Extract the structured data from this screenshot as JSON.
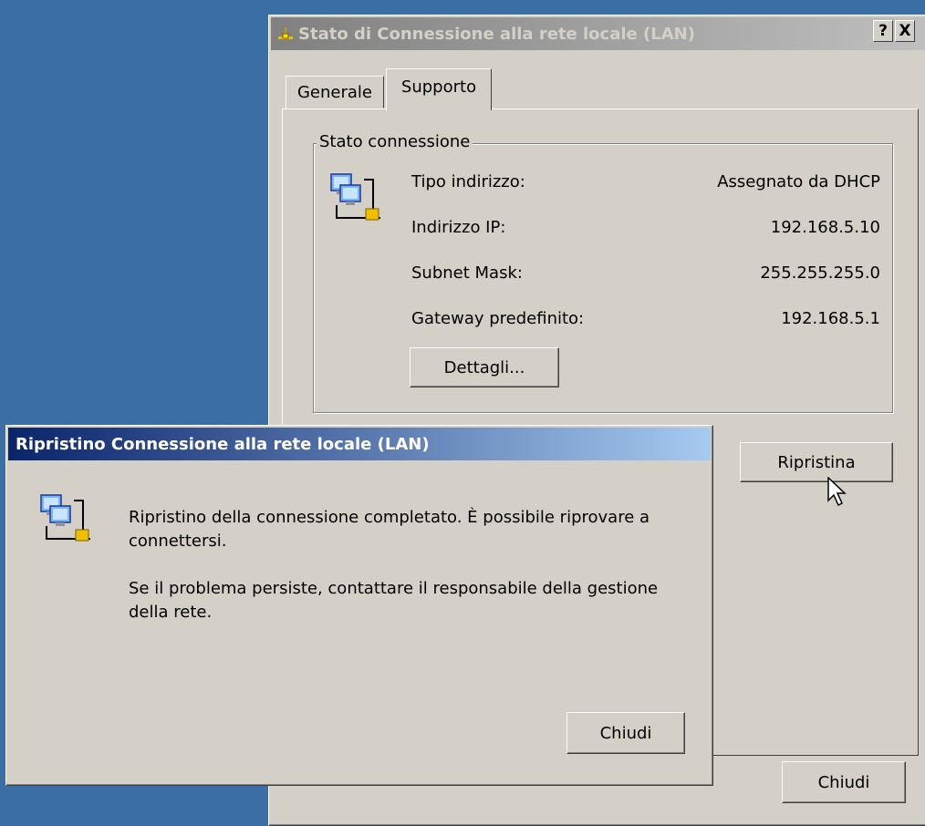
{
  "status_window": {
    "title": "Stato di Connessione alla rete locale (LAN)",
    "help_btn": "?",
    "close_btn": "X",
    "tabs": [
      "Generale",
      "Supporto"
    ],
    "group_title": "Stato connessione",
    "rows": [
      {
        "label": "Tipo indirizzo:",
        "value": "Assegnato da DHCP"
      },
      {
        "label": "Indirizzo IP:",
        "value": "192.168.5.10"
      },
      {
        "label": "Subnet Mask:",
        "value": "255.255.255.0"
      },
      {
        "label": "Gateway predefinito:",
        "value": "192.168.5.1"
      }
    ],
    "details_button": "Dettagli...",
    "repair_button": "Ripristina",
    "close_button": "Chiudi"
  },
  "repair_dialog": {
    "title": "Ripristino Connessione alla rete locale (LAN)",
    "message1": "Ripristino della connessione completato. È possibile riprovare a connettersi.",
    "message2": "Se il problema persiste, contattare il responsabile della gestione della rete.",
    "close_button": "Chiudi"
  },
  "icons": {
    "network": "network-connection-icon",
    "cursor": "mouse-cursor-icon"
  },
  "colors": {
    "desktop": "#3a6ea5",
    "active_title": "#0a246a",
    "inactive_title": "#808080",
    "face": "#d4d0c8"
  }
}
